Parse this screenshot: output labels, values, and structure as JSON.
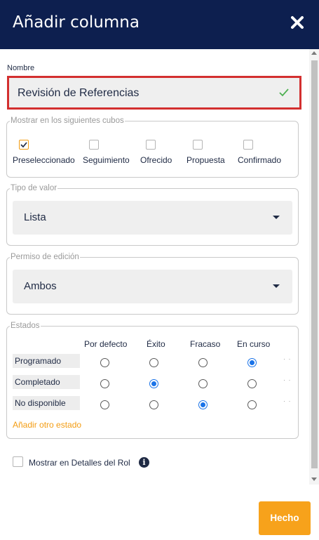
{
  "dialog": {
    "title": "Añadir columna",
    "close_icon": "close-icon"
  },
  "name_field": {
    "label": "Nombre",
    "value": "Revisión de Referencias",
    "valid_icon": "check-icon",
    "valid_color": "#4caf50"
  },
  "cubes": {
    "legend": "Mostrar en los siguientes cubos",
    "items": [
      {
        "label": "Preseleccionado",
        "checked": true
      },
      {
        "label": "Seguimiento",
        "checked": false
      },
      {
        "label": "Ofrecido",
        "checked": false
      },
      {
        "label": "Propuesta",
        "checked": false
      },
      {
        "label": "Confirmado",
        "checked": false
      }
    ]
  },
  "value_type": {
    "legend": "Tipo de valor",
    "selected": "Lista"
  },
  "edit_permission": {
    "legend": "Permiso de edición",
    "selected": "Ambos"
  },
  "states": {
    "legend": "Estados",
    "columns": [
      "Por defecto",
      "Éxito",
      "Fracaso",
      "En curso"
    ],
    "rows": [
      {
        "label": "Programado",
        "selected": "En curso"
      },
      {
        "label": "Completado",
        "selected": "Éxito"
      },
      {
        "label": "No disponible",
        "selected": "Fracaso"
      }
    ],
    "add_label": "Añadir otro estado"
  },
  "show_role": {
    "label": "Mostrar en Detalles del Rol",
    "checked": false,
    "info_icon": "info-icon"
  },
  "footer": {
    "done_label": "Hecho"
  },
  "colors": {
    "header_bg": "#0d1f4f",
    "accent": "#f7a21b",
    "error_border": "#d32f2f",
    "radio_selected": "#1a73e8"
  }
}
